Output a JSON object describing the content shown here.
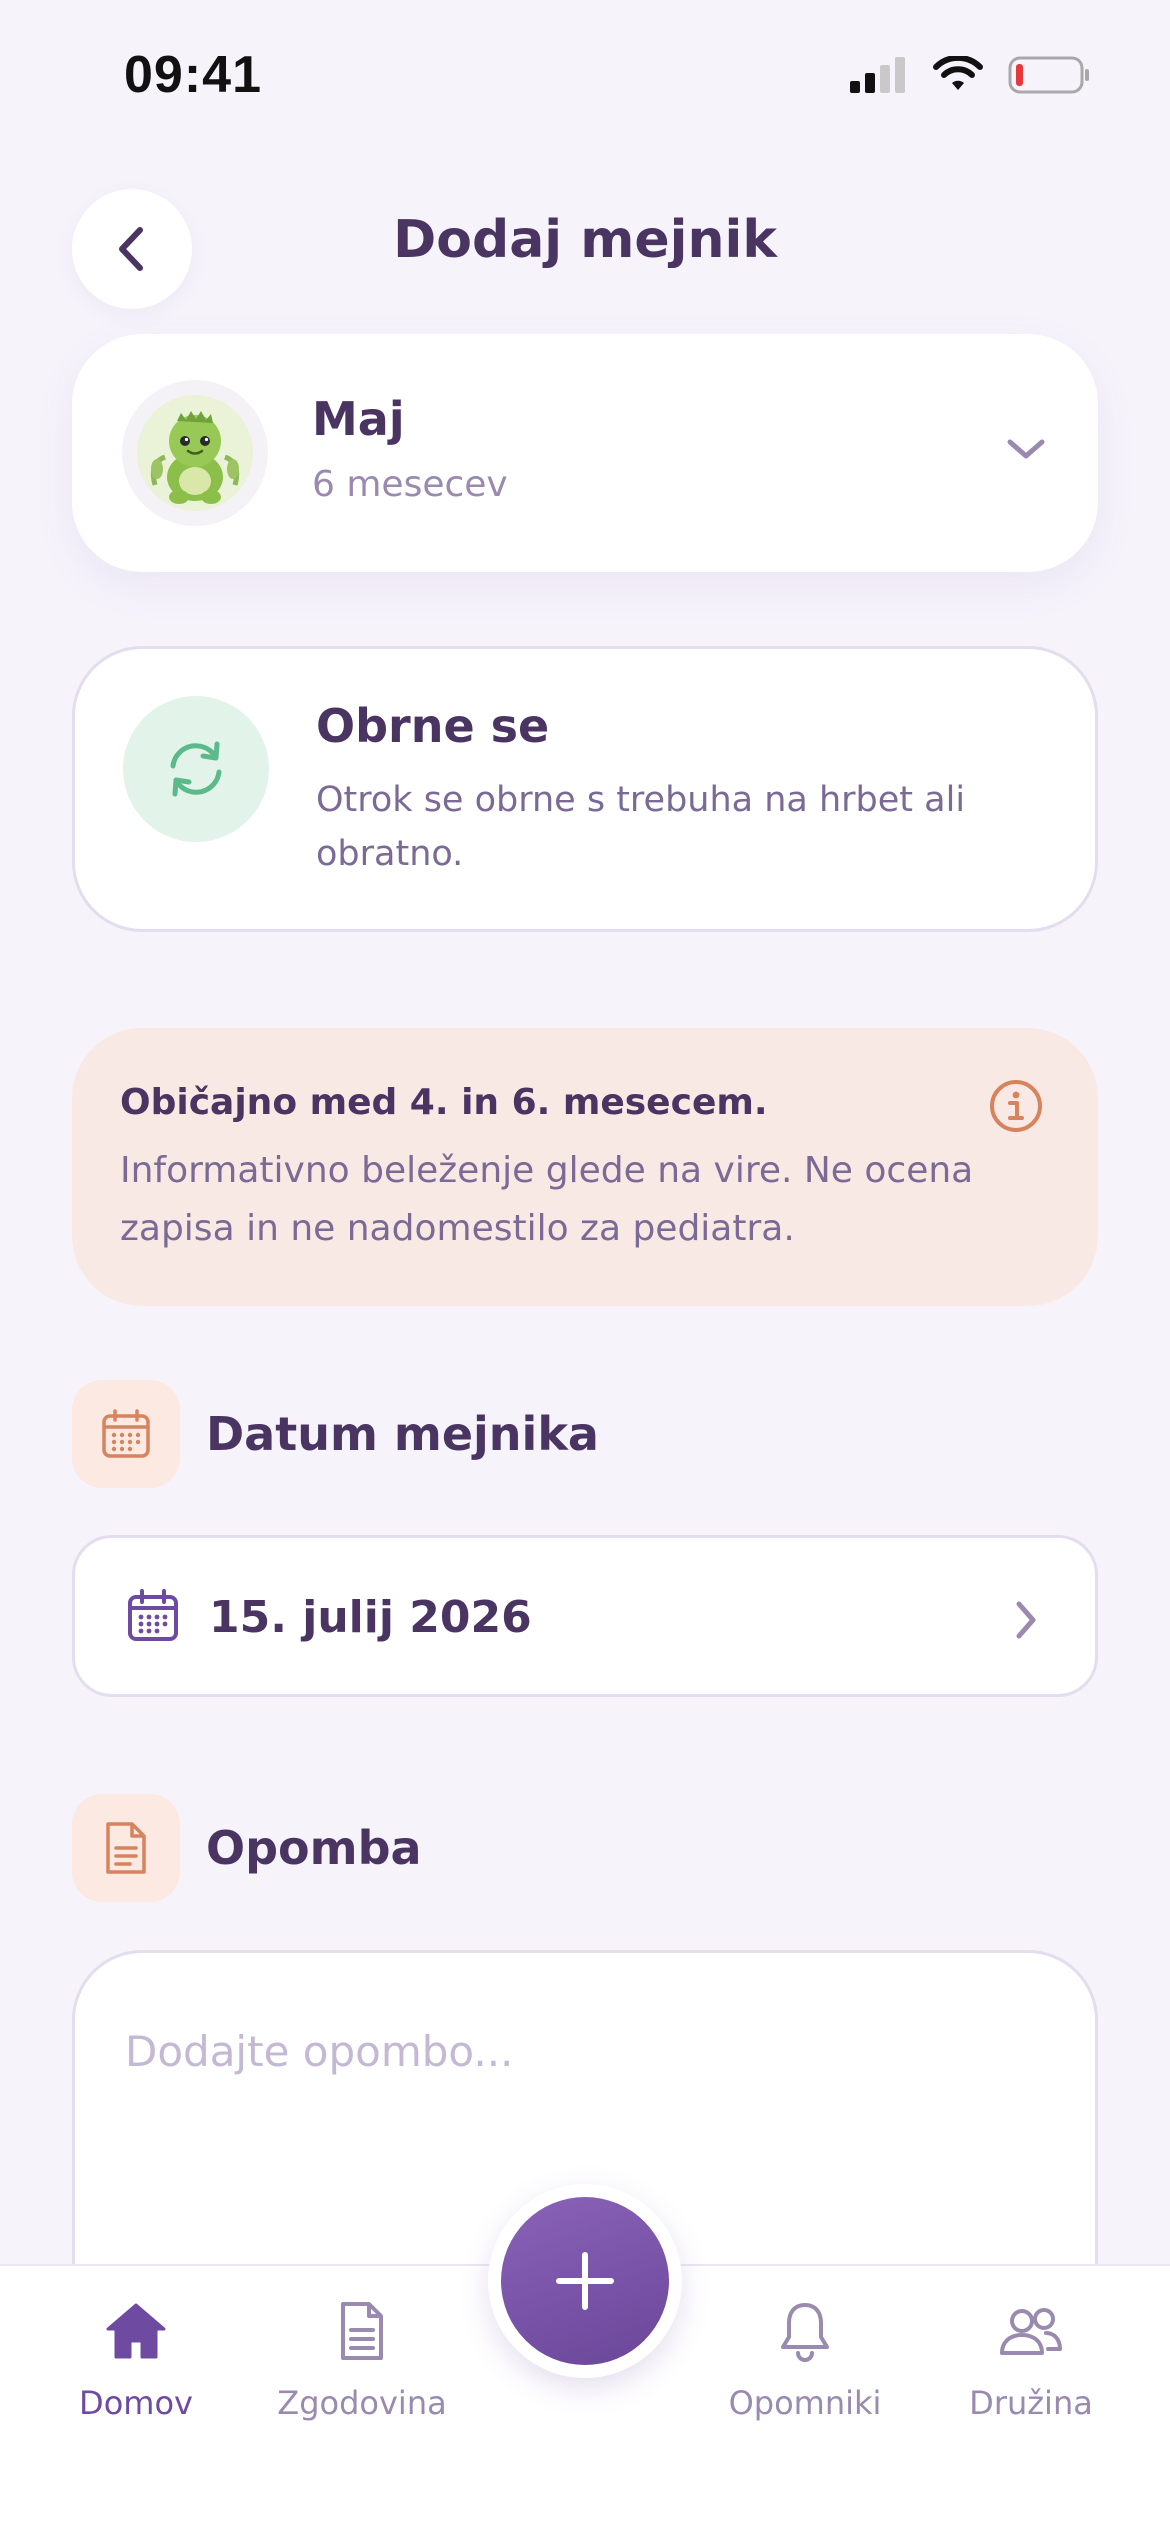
{
  "status_bar": {
    "time": "09:41"
  },
  "header": {
    "title": "Dodaj mejnik"
  },
  "child": {
    "name": "Maj",
    "age": "6 mesecev"
  },
  "milestone": {
    "title": "Obrne se",
    "description": "Otrok se obrne s trebuha na hrbet ali obratno."
  },
  "info": {
    "title": "Običajno med 4. in 6. mesecem.",
    "text": "Informativno beleženje glede na vire. Ne ocena zapisa in ne nadomestilo za pediatra."
  },
  "date_section": {
    "label": "Datum mejnika",
    "value": "15. julij 2026"
  },
  "note_section": {
    "label": "Opomba",
    "placeholder": "Dodajte opombo..."
  },
  "tabs": [
    {
      "label": "Domov",
      "icon": "home-icon",
      "active": true
    },
    {
      "label": "Zgodovina",
      "icon": "document-icon",
      "active": false
    },
    {
      "label": "Opomniki",
      "icon": "bell-icon",
      "active": false
    },
    {
      "label": "Družina",
      "icon": "people-icon",
      "active": false
    }
  ],
  "colors": {
    "primary": "#6E4BA0",
    "text": "#4A3562",
    "muted": "#9A8AB0",
    "background": "#F6F3FB",
    "accent_orange": "#D6835E",
    "accent_green": "#5BB98A"
  }
}
